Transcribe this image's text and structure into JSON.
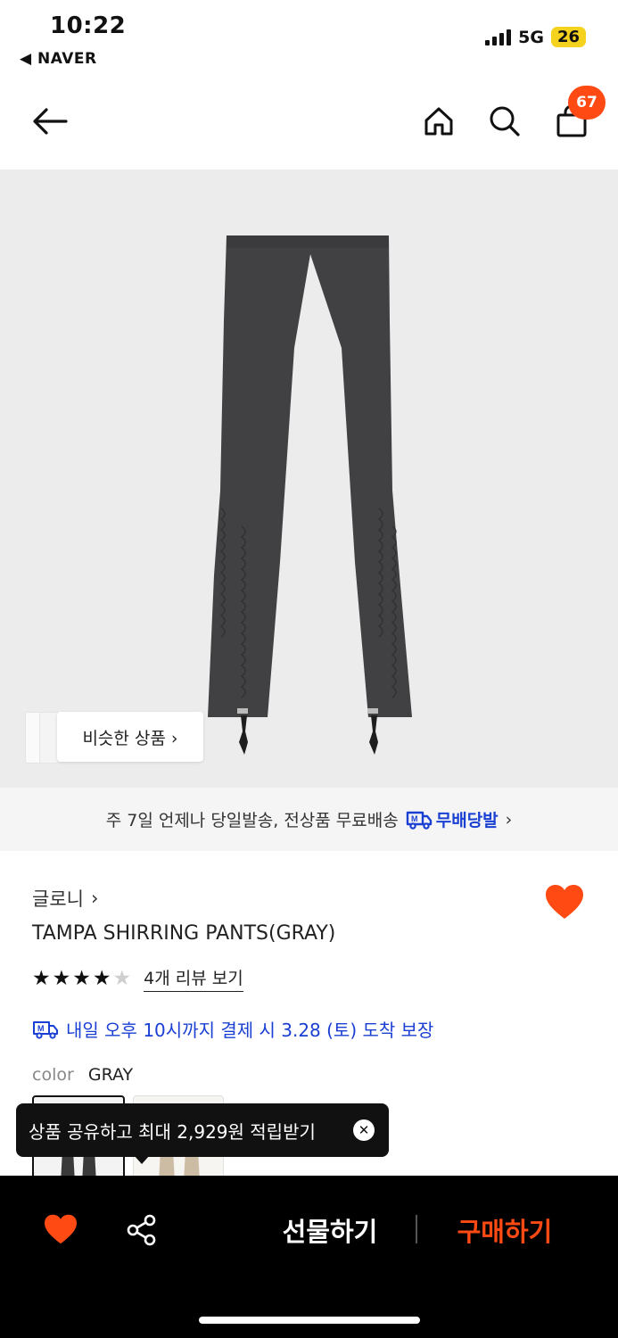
{
  "status_bar": {
    "time": "10:22",
    "back_app": "◀ NAVER",
    "network": "5G",
    "battery": "26"
  },
  "header": {
    "cart_count": "67",
    "icons": [
      "back-arrow-icon",
      "home-icon",
      "search-icon",
      "shopping-bag-icon"
    ]
  },
  "product_image": {
    "similar_label": "비슷한 상품 ›"
  },
  "shipping_banner": {
    "text": "주 7일 언제나 당일발송, 전상품 무료배송",
    "brand": "무배당발",
    "chevron": "›"
  },
  "product": {
    "brand": "글로니",
    "brand_chevron": "›",
    "name": "TAMPA SHIRRING PANTS(GRAY)",
    "rating": 4,
    "rating_max": 5,
    "review_link": "4개 리뷰 보기",
    "delivery_note": "내일 오후 10시까지 결제 시 3.28 (토) 도착 보장",
    "color_label": "color",
    "color_value": "GRAY"
  },
  "tooltip": {
    "text": "상품 공유하고 최대 2,929원 적립받기",
    "close": "✕"
  },
  "bottom_bar": {
    "gift_label": "선물하기",
    "buy_label": "구매하기"
  },
  "colors": {
    "accent": "#ff4a14",
    "brand_blue": "#1a3fd3",
    "product_gray": "#414143",
    "background_gray": "#ececec"
  }
}
